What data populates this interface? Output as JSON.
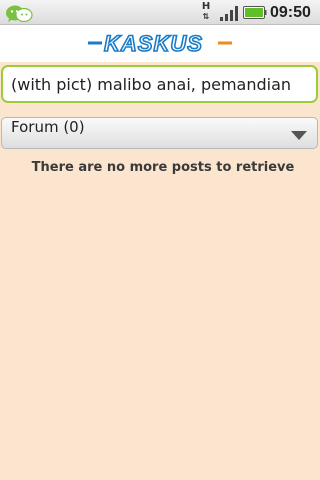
{
  "status_bar": {
    "notification_icon": "chat-icon",
    "network_type": "H",
    "signal_icon": "signal-icon",
    "battery_icon": "battery-icon",
    "time": "09:50"
  },
  "header": {
    "logo_text": "KASKUS"
  },
  "search": {
    "value": "(with pict) malibo anai, pemandian"
  },
  "forum_filter": {
    "label": "Forum (0)",
    "icon": "chevron-down-icon"
  },
  "results": {
    "empty_message": "There are no more posts to retrieve"
  },
  "colors": {
    "background": "#fbe5cf",
    "search_border": "#9ccb3c",
    "logo_blue": "#1a7cc8",
    "logo_orange": "#f08a1c"
  }
}
